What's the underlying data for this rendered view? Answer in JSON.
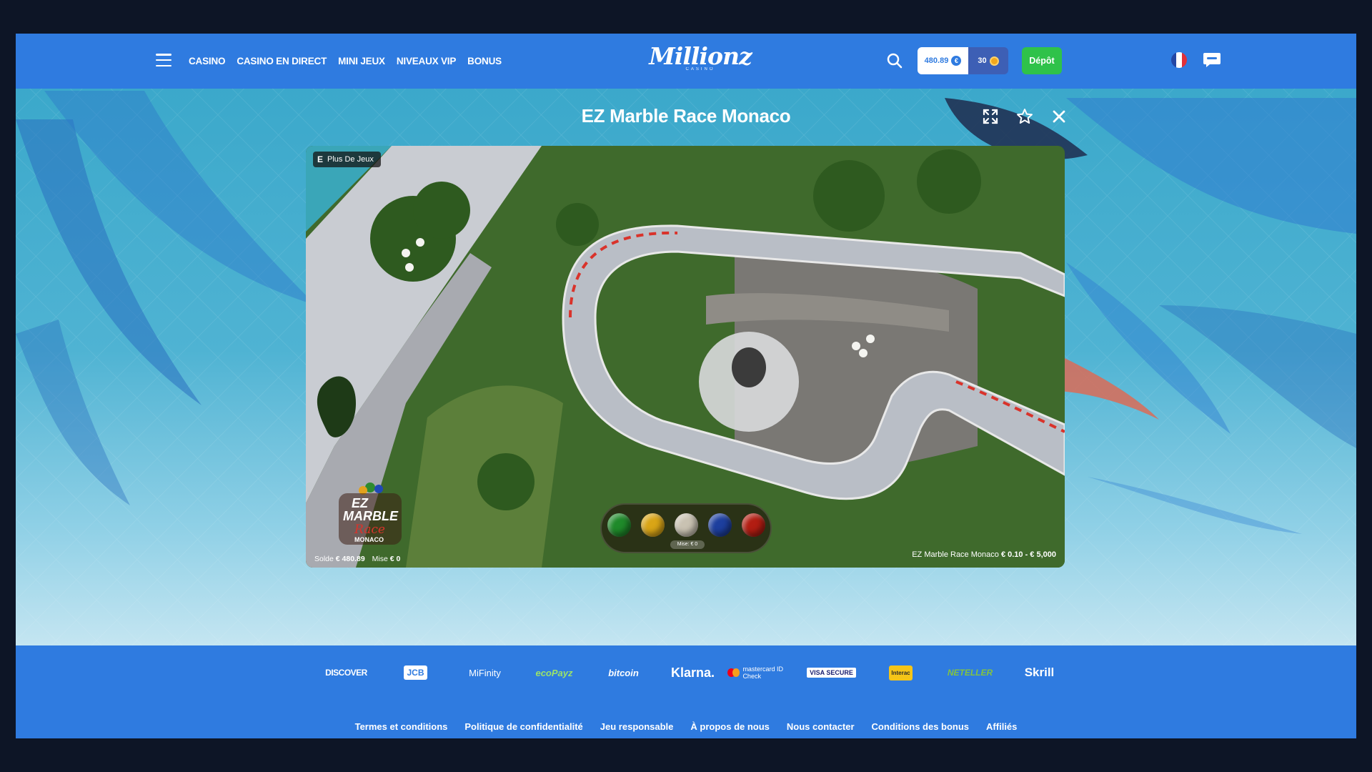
{
  "header": {
    "nav": [
      "CASINO",
      "CASINO EN DIRECT",
      "MINI JEUX",
      "NIVEAUX VIP",
      "BONUS"
    ],
    "logo_text": "Millionz",
    "logo_sub": "CASINO",
    "balance": "480.89",
    "points": "30",
    "deposit_label": "Dépôt"
  },
  "game": {
    "title": "EZ Marble Race Monaco",
    "more_games_label": "Plus De Jeux",
    "logo_lines": [
      "EZ",
      "MARBLE",
      "Race",
      "MONACO"
    ],
    "balance_label": "Solde",
    "balance_value": "€ 480.89",
    "bet_label": "Mise",
    "bet_value": "€ 0",
    "limits_name": "EZ Marble Race Monaco",
    "limits_range": "€ 0.10 - € 5,000",
    "marble_bet_label": "Mise: € 0",
    "marble_colors": [
      "#1f8a2a",
      "#d9a516",
      "#c9c2b2",
      "#1d3f9e",
      "#b21d12"
    ]
  },
  "footer": {
    "payments": [
      "DISCOVER",
      "JCB",
      "MiFinity",
      "ecoPayz",
      "bitcoin",
      "Klarna.",
      "mastercard ID Check",
      "VISA SECURE",
      "Interac",
      "NETELLER",
      "Skrill"
    ],
    "links": [
      "Termes et conditions",
      "Politique de confidentialité",
      "Jeu responsable",
      "À propos de nous",
      "Nous contacter",
      "Conditions des bonus",
      "Affiliés"
    ]
  }
}
